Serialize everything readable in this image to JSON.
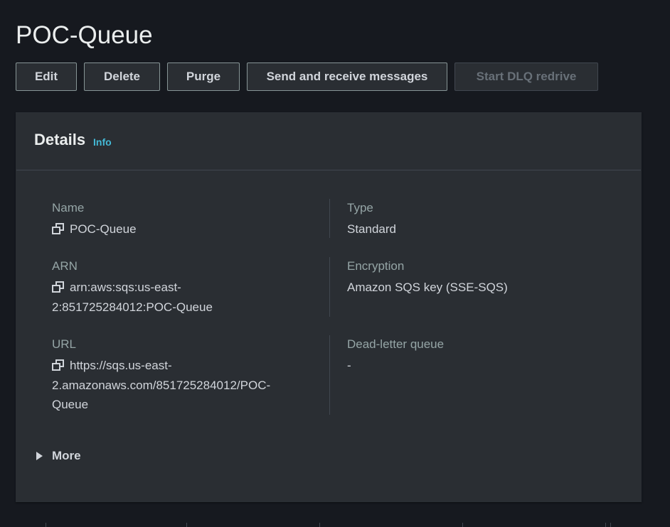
{
  "page": {
    "title": "POC-Queue"
  },
  "toolbar": {
    "edit_label": "Edit",
    "delete_label": "Delete",
    "purge_label": "Purge",
    "send_receive_label": "Send and receive messages",
    "dlq_redrive_label": "Start DLQ redrive"
  },
  "details": {
    "title": "Details",
    "info_label": "Info",
    "name_label": "Name",
    "name_value": "POC-Queue",
    "type_label": "Type",
    "type_value": "Standard",
    "arn_label": "ARN",
    "arn_line1": "arn:aws:sqs:us-east-",
    "arn_line2": "2:851725284012:POC-Queue",
    "encryption_label": "Encryption",
    "encryption_value": "Amazon SQS key (SSE-SQS)",
    "url_label": "URL",
    "url_line1": "https://sqs.us-east-",
    "url_line2": "2.amazonaws.com/851725284012/POC-",
    "url_line3": "Queue",
    "dlq_label": "Dead-letter queue",
    "dlq_value": "-",
    "more_label": "More"
  },
  "icons": {
    "copy": "copy-icon",
    "expand": "caret-right-icon"
  },
  "colors": {
    "background": "#16191f",
    "panel": "#2a2e33",
    "link": "#44b9d6",
    "label": "#95a5a6"
  }
}
